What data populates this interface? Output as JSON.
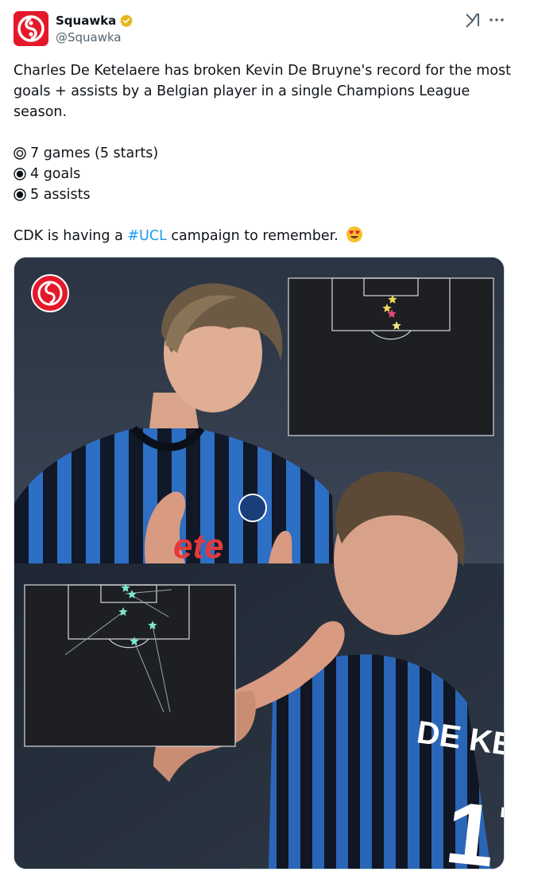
{
  "author": {
    "display_name": "Squawka",
    "handle": "@Squawka",
    "verified": true,
    "avatar_icon": "squawka-logo-icon",
    "brand_color": "#e5182a",
    "verified_color": "#e2b719"
  },
  "header_actions": {
    "grok_icon": "grok-icon",
    "more_icon": "more-dots-icon"
  },
  "tweet": {
    "intro": "Charles De Ketelaere has broken Kevin De Bruyne's record for the most goals + assists by a Belgian player in a single Champions League season.",
    "stats": [
      {
        "icon": "circled-ring-icon",
        "text": "7 games (5 starts)"
      },
      {
        "icon": "filled-circle-icon",
        "text": "4 goals"
      },
      {
        "icon": "filled-circle-icon",
        "text": "5 assists"
      }
    ],
    "closing_before": "CDK is having a",
    "hashtag": "#UCL",
    "closing_after": "campaign to remember.",
    "emoji": "heart-eyes-emoji-icon",
    "hashtag_color": "#1d9bf0"
  },
  "media": {
    "description_icons": [
      "squawka-logo-icon",
      "goals-shot-map",
      "assists-shot-map"
    ],
    "goal_star_colors": [
      "#f3d35a",
      "#f3d35a",
      "#e84a7a",
      "#f3e48a"
    ],
    "assist_star_color": "#7ee6cf"
  }
}
